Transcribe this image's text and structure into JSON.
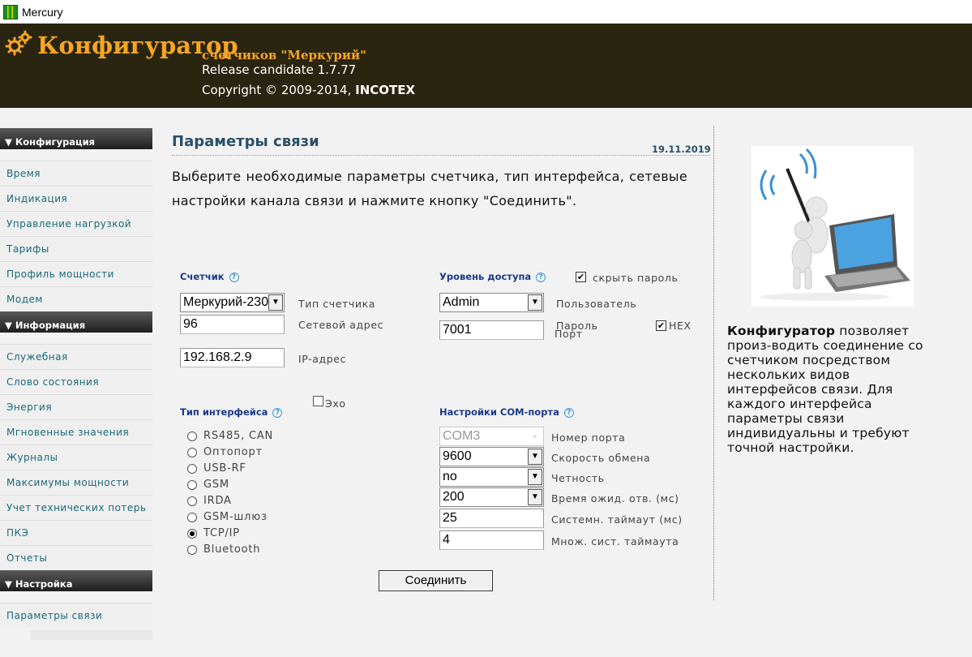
{
  "window": {
    "title": "Mercury"
  },
  "header": {
    "brand": "Конфигуратор",
    "subtitle": "счетчиков \"Меркурий\"",
    "release": "Release candidate 1.7.77",
    "copyright_prefix": "Copyright © 2009-2014, ",
    "copyright_company": "INCOTEX"
  },
  "sidebar": {
    "sections": [
      {
        "title": "▼ Конфигурация",
        "items": [
          "Время",
          "Индикация",
          "Управление нагрузкой",
          "Тарифы",
          "Профиль мощности",
          "Модем"
        ]
      },
      {
        "title": "▼ Информация",
        "items": [
          "Служебная",
          "Слово состояния",
          "Энергия",
          "Мгновенные значения",
          "Журналы",
          "Максимумы мощности",
          "Учет технических потерь",
          "ПКЭ",
          "Отчеты"
        ]
      },
      {
        "title": "▼ Настройка",
        "items": [
          "Параметры связи"
        ]
      }
    ]
  },
  "main": {
    "title": "Параметры связи",
    "date": "19.11.2019",
    "intro": "Выберите необходимые параметры счетчика, тип интерфейса, сетевые настройки канала связи и нажмите кнопку \"Соединить\".",
    "meter": {
      "label": "Счетчик",
      "type_value": "Меркурий-230",
      "type_label": "Тип счетчика",
      "address_value": "96",
      "address_label": "Сетевой адрес",
      "ip_value": "192.168.2.9",
      "ip_label": "IP-адрес"
    },
    "access": {
      "label": "Уровень доступа",
      "hide_password_label": "скрыть пароль",
      "hide_password_checked": "✔",
      "user_value": "Admin",
      "user_label": "Пользователь",
      "password_label": "Пароль",
      "port_value": "7001",
      "port_label": "Порт",
      "hex_label": "HEX",
      "hex_checked": "✔"
    },
    "interface": {
      "label": "Тип интерфейса",
      "echo_label": "Эхо",
      "options": [
        "RS485, CAN",
        "Оптопорт",
        "USB-RF",
        "GSM",
        "IRDA",
        "GSM-шлюз",
        "TCP/IP",
        "Bluetooth"
      ],
      "selected": "TCP/IP"
    },
    "com": {
      "label": "Настройки COM-порта",
      "port_value": "COM3",
      "port_label": "Номер порта",
      "baud_value": "9600",
      "baud_label": "Скорость обмена",
      "parity_value": "no",
      "parity_label": "Четность",
      "timeout_value": "200",
      "timeout_label": "Время ожид. отв. (мс)",
      "sys_timeout_value": "25",
      "sys_timeout_label": "Системн. таймаут (мс)",
      "mult_value": "4",
      "mult_label": "Множ. сист. таймаута"
    },
    "connect_label": "Соединить"
  },
  "aside": {
    "bold": "Конфигуратор",
    "text": " позволяет произ-водить соединение со счетчиком посредством нескольких видов интерфейсов связи. Для каждого интерфейса параметры связи индивидуальны и требуют точной настройки."
  },
  "colors": {
    "header_bg": "#2a2510",
    "brand": "#f5a623",
    "accent": "#1a3a8a",
    "nav_text": "#1a6a7a"
  }
}
